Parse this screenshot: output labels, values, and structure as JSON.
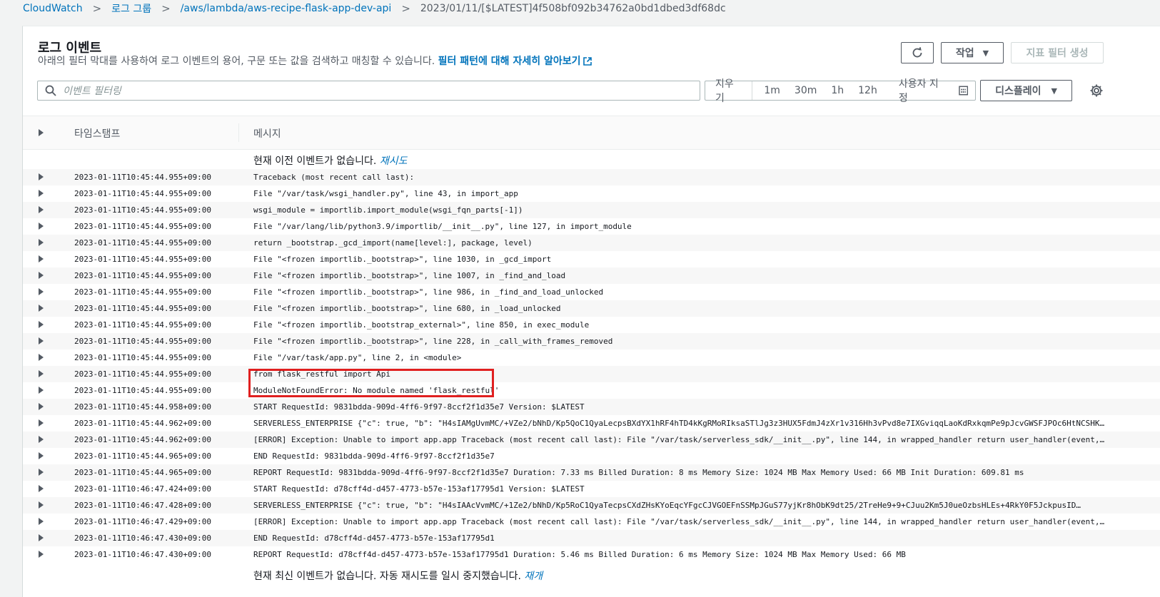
{
  "breadcrumb": [
    {
      "label": "CloudWatch"
    },
    {
      "label": "로그 그룹"
    },
    {
      "label": "/aws/lambda/aws-recipe-flask-app-dev-api"
    },
    {
      "label": "2023/01/11/[$LATEST]4f508bf092b34762a0bd1dbed3df68dc"
    }
  ],
  "panel": {
    "title": "로그 이벤트",
    "description": "아래의 필터 막대를 사용하여 로그 이벤트의 용어, 구문 또는 값을 검색하고 매칭할 수 있습니다.",
    "learn_more": "필터 패턴에 대해 자세히 알아보기"
  },
  "toolbar": {
    "actions_label": "작업",
    "create_metric_filter_label": "지표 필터 생성",
    "display_label": "디스플레이"
  },
  "search": {
    "placeholder": "이벤트 필터링"
  },
  "time_range": {
    "clear": "지우기",
    "options": [
      "1m",
      "30m",
      "1h",
      "12h"
    ],
    "custom": "사용자 지정"
  },
  "table": {
    "col_timestamp": "타임스탬프",
    "col_message": "메시지",
    "top_notice": "현재 이전 이벤트가 없습니다.",
    "retry": "재시도",
    "bottom_notice": "현재 최신 이벤트가 없습니다. 자동 재시도를 일시 중지했습니다.",
    "bottom_retry": "재개",
    "rows": [
      {
        "ts": "2023-01-11T10:45:44.955+09:00",
        "msg": "Traceback (most recent call last):"
      },
      {
        "ts": "2023-01-11T10:45:44.955+09:00",
        "msg": "File \"/var/task/wsgi_handler.py\", line 43, in import_app"
      },
      {
        "ts": "2023-01-11T10:45:44.955+09:00",
        "msg": "wsgi_module = importlib.import_module(wsgi_fqn_parts[-1])"
      },
      {
        "ts": "2023-01-11T10:45:44.955+09:00",
        "msg": "File \"/var/lang/lib/python3.9/importlib/__init__.py\", line 127, in import_module"
      },
      {
        "ts": "2023-01-11T10:45:44.955+09:00",
        "msg": "return _bootstrap._gcd_import(name[level:], package, level)"
      },
      {
        "ts": "2023-01-11T10:45:44.955+09:00",
        "msg": "File \"<frozen importlib._bootstrap>\", line 1030, in _gcd_import"
      },
      {
        "ts": "2023-01-11T10:45:44.955+09:00",
        "msg": "File \"<frozen importlib._bootstrap>\", line 1007, in _find_and_load"
      },
      {
        "ts": "2023-01-11T10:45:44.955+09:00",
        "msg": "File \"<frozen importlib._bootstrap>\", line 986, in _find_and_load_unlocked"
      },
      {
        "ts": "2023-01-11T10:45:44.955+09:00",
        "msg": "File \"<frozen importlib._bootstrap>\", line 680, in _load_unlocked"
      },
      {
        "ts": "2023-01-11T10:45:44.955+09:00",
        "msg": "File \"<frozen importlib._bootstrap_external>\", line 850, in exec_module"
      },
      {
        "ts": "2023-01-11T10:45:44.955+09:00",
        "msg": "File \"<frozen importlib._bootstrap>\", line 228, in _call_with_frames_removed"
      },
      {
        "ts": "2023-01-11T10:45:44.955+09:00",
        "msg": "File \"/var/task/app.py\", line 2, in <module>"
      },
      {
        "ts": "2023-01-11T10:45:44.955+09:00",
        "msg": "from flask_restful import Api"
      },
      {
        "ts": "2023-01-11T10:45:44.955+09:00",
        "msg": "ModuleNotFoundError: No module named 'flask_restful'"
      },
      {
        "ts": "2023-01-11T10:45:44.958+09:00",
        "msg": "START RequestId: 9831bdda-909d-4ff6-9f97-8ccf2f1d35e7 Version: $LATEST"
      },
      {
        "ts": "2023-01-11T10:45:44.962+09:00",
        "msg": "SERVERLESS_ENTERPRISE {\"c\": true, \"b\": \"H4sIAMgUvmMC/+VZe2/bNhD/Kp5QoC1QyaLecpsBXdYX1hRF4hTD4kKgRMoRIksaSTlJg3z3HUX5FdmJ4zXr1v316Hh3vPvd8e7IXGviqqLaoKdRxkqmPe9pJcvGWSFJPOc6HtNCSHKFr/ISE6…"
      },
      {
        "ts": "2023-01-11T10:45:44.962+09:00",
        "msg": "[ERROR] Exception: Unable to import app.app Traceback (most recent call last):   File \"/var/task/serverless_sdk/__init__.py\", line 144, in wrapped_handler     return user_handler(event, …"
      },
      {
        "ts": "2023-01-11T10:45:44.965+09:00",
        "msg": "END RequestId: 9831bdda-909d-4ff6-9f97-8ccf2f1d35e7"
      },
      {
        "ts": "2023-01-11T10:45:44.965+09:00",
        "msg": "REPORT RequestId: 9831bdda-909d-4ff6-9f97-8ccf2f1d35e7 Duration: 7.33 ms Billed Duration: 8 ms Memory Size: 1024 MB Max Memory Used: 66 MB Init Duration: 609.81 ms"
      },
      {
        "ts": "2023-01-11T10:46:47.424+09:00",
        "msg": "START RequestId: d78cff4d-d457-4773-b57e-153af17795d1 Version: $LATEST"
      },
      {
        "ts": "2023-01-11T10:46:47.428+09:00",
        "msg": "SERVERLESS_ENTERPRISE {\"c\": true, \"b\": \"H4sIAAcVvmMC/+1Ze2/bNhD/Kp5RoC1QyaTecpsCXdZHsKYoEqcYFgcCJVGOEFnSSMpJGuS77yjKr8hObK9dt25/2TreHe9+9+CJuu2Km5J0ueOzbsHLEs+4RkY0F5JckpusID…"
      },
      {
        "ts": "2023-01-11T10:46:47.429+09:00",
        "msg": "[ERROR] Exception: Unable to import app.app Traceback (most recent call last):   File \"/var/task/serverless_sdk/__init__.py\", line 144, in wrapped_handler     return user_handler(event, …"
      },
      {
        "ts": "2023-01-11T10:46:47.430+09:00",
        "msg": "END RequestId: d78cff4d-d457-4773-b57e-153af17795d1"
      },
      {
        "ts": "2023-01-11T10:46:47.430+09:00",
        "msg": "REPORT RequestId: d78cff4d-d457-4773-b57e-153af17795d1 Duration: 5.46 ms Billed Duration: 6 ms Memory Size: 1024 MB Max Memory Used: 66 MB"
      }
    ]
  }
}
